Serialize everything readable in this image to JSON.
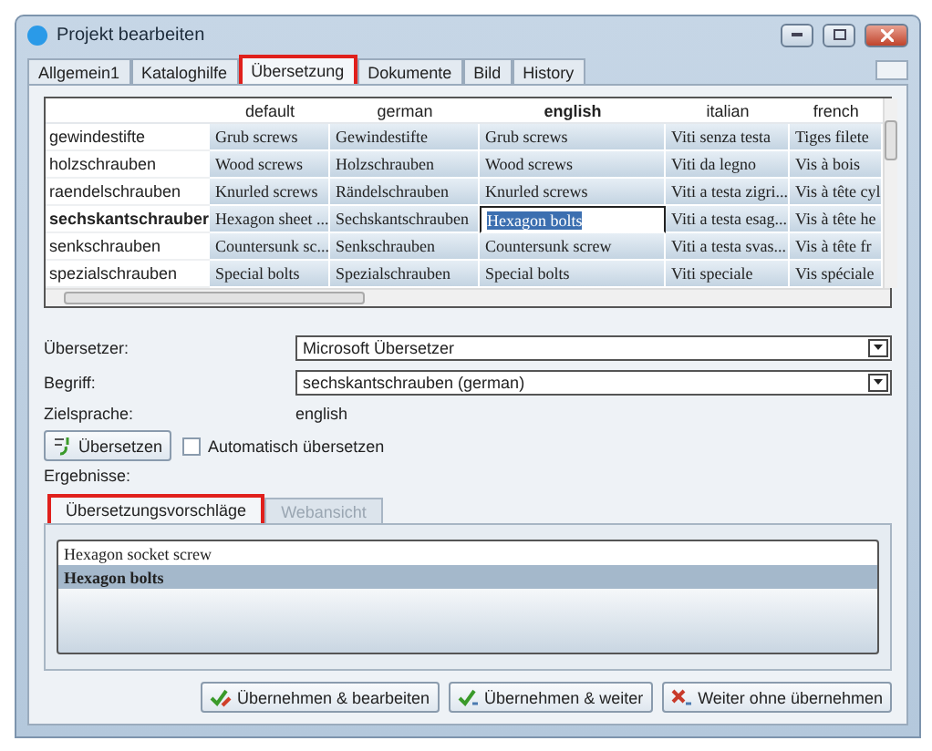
{
  "window": {
    "title": "Projekt bearbeiten"
  },
  "tabs": [
    {
      "label": "Allgemein1",
      "selected": false,
      "highlighted": false
    },
    {
      "label": "Kataloghilfe",
      "selected": false,
      "highlighted": false
    },
    {
      "label": "Übersetzung",
      "selected": true,
      "highlighted": true
    },
    {
      "label": "Dokumente",
      "selected": false,
      "highlighted": false
    },
    {
      "label": "Bild",
      "selected": false,
      "highlighted": false
    },
    {
      "label": "History",
      "selected": false,
      "highlighted": false
    }
  ],
  "table": {
    "columns": [
      {
        "label": "default",
        "selected": false
      },
      {
        "label": "german",
        "selected": false
      },
      {
        "label": "english",
        "selected": true
      },
      {
        "label": "italian",
        "selected": false
      },
      {
        "label": "french",
        "selected": false
      }
    ],
    "rows": [
      {
        "label": "gewindestifte",
        "selected": false,
        "cells": [
          {
            "text": "Grub screws",
            "editing": false
          },
          {
            "text": "Gewindestifte",
            "editing": false
          },
          {
            "text": "Grub screws",
            "editing": false
          },
          {
            "text": "Viti senza testa",
            "editing": false
          },
          {
            "text": "Tiges filete",
            "editing": false
          }
        ]
      },
      {
        "label": "holzschrauben",
        "selected": false,
        "cells": [
          {
            "text": "Wood screws",
            "editing": false
          },
          {
            "text": "Holzschrauben",
            "editing": false
          },
          {
            "text": "Wood screws",
            "editing": false
          },
          {
            "text": "Viti da legno",
            "editing": false
          },
          {
            "text": "Vis à bois",
            "editing": false
          }
        ]
      },
      {
        "label": "raendelschrauben",
        "selected": false,
        "cells": [
          {
            "text": "Knurled screws",
            "editing": false
          },
          {
            "text": "Rändelschrauben",
            "editing": false
          },
          {
            "text": "Knurled screws",
            "editing": false
          },
          {
            "text": "Viti a testa zigri...",
            "editing": false
          },
          {
            "text": "Vis à tête cyl",
            "editing": false
          }
        ]
      },
      {
        "label": "sechskantschrauber",
        "selected": true,
        "cells": [
          {
            "text": "Hexagon sheet ...",
            "editing": false
          },
          {
            "text": "Sechskantschrauben",
            "editing": false
          },
          {
            "text": "Hexagon bolts",
            "editing": true
          },
          {
            "text": "Viti a testa esag...",
            "editing": false
          },
          {
            "text": "Vis à tête he",
            "editing": false
          }
        ]
      },
      {
        "label": "senkschrauben",
        "selected": false,
        "cells": [
          {
            "text": "Countersunk sc...",
            "editing": false
          },
          {
            "text": "Senkschrauben",
            "editing": false
          },
          {
            "text": "Countersunk screw",
            "editing": false
          },
          {
            "text": "Viti a testa svas...",
            "editing": false
          },
          {
            "text": "Vis à tête fr",
            "editing": false
          }
        ]
      },
      {
        "label": "spezialschrauben",
        "selected": false,
        "cells": [
          {
            "text": "Special bolts",
            "editing": false
          },
          {
            "text": "Spezialschrauben",
            "editing": false
          },
          {
            "text": "Special bolts",
            "editing": false
          },
          {
            "text": "Viti speciale",
            "editing": false
          },
          {
            "text": "Vis spéciale",
            "editing": false
          }
        ]
      }
    ]
  },
  "form": {
    "translator": {
      "label": "Übersetzer:",
      "value": "Microsoft Übersetzer"
    },
    "term": {
      "label": "Begriff:",
      "value": "sechskantschrauben (german)"
    },
    "target_language": {
      "label": "Zielsprache:",
      "value": "english"
    },
    "translate_button": "Übersetzen",
    "auto_translate": {
      "label": "Automatisch übersetzen",
      "checked": false
    },
    "results_label": "Ergebnisse:"
  },
  "result_tabs": [
    {
      "label": "Übersetzungsvorschläge",
      "selected": true,
      "highlighted": true
    },
    {
      "label": "Webansicht",
      "selected": false,
      "highlighted": false
    }
  ],
  "suggestions": [
    {
      "text": "Hexagon socket screw",
      "selected": false
    },
    {
      "text": "Hexagon bolts",
      "selected": true
    }
  ],
  "buttons": [
    {
      "label": "Übernehmen & bearbeiten",
      "kind": "edit"
    },
    {
      "label": "Übernehmen & weiter",
      "kind": "next"
    },
    {
      "label": "Weiter ohne übernehmen",
      "kind": "skip"
    }
  ]
}
